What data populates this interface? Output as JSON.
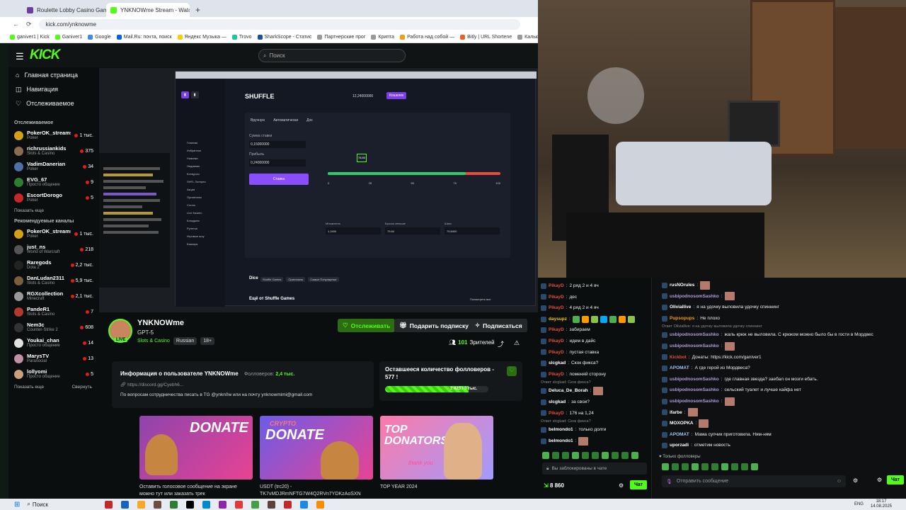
{
  "browser": {
    "tabs": [
      {
        "label": "Roulette Lobby Casino Game o",
        "color": "#6b3fa0",
        "active": false
      },
      {
        "label": "YNKNOWme Stream - Watch",
        "color": "#53fc18",
        "active": true
      }
    ],
    "url": "kick.com/ynknowme",
    "bookmarks": [
      "ganiver1 | Kick",
      "Ganiver1",
      "Google",
      "Mail.Ru: почта, поиск",
      "Яндекс Музыка —",
      "Trovo",
      "SharkScope - Статис",
      "Партнерские прог",
      "Крипта",
      "Работа над собой —",
      "Bitly | URL Shortene",
      "Калькулятор"
    ]
  },
  "kick": {
    "logo": "KICK",
    "search_placeholder": "Поиск",
    "nav": [
      {
        "label": "Главная страница",
        "icon": "home-icon"
      },
      {
        "label": "Навигация",
        "icon": "compass-icon"
      },
      {
        "label": "Отслеживаемое",
        "icon": "heart-icon"
      }
    ],
    "followed_title": "Отслеживаемое",
    "followed": [
      {
        "name": "PokerOK_streams",
        "cat": "Poker",
        "viewers": "1 тыс.",
        "color": "#d4a017"
      },
      {
        "name": "richrussiankids",
        "cat": "Slots & Casino",
        "viewers": "375",
        "color": "#8a6d4e"
      },
      {
        "name": "VadimDanerian",
        "cat": "Poker",
        "viewers": "34",
        "color": "#4f6fa8"
      },
      {
        "name": "EVG_67",
        "cat": "Просто общение",
        "viewers": "9",
        "color": "#2e7d32"
      },
      {
        "name": "EscortDorogo",
        "cat": "Poker",
        "viewers": "5",
        "color": "#c62828"
      }
    ],
    "show_more": "Показать еще",
    "recommended_title": "Рекомендуемые каналы",
    "recommended": [
      {
        "name": "PokerOK_streams",
        "cat": "Poker",
        "viewers": "1 тыс.",
        "color": "#d4a017"
      },
      {
        "name": "just_ns",
        "cat": "World of Warcraft",
        "viewers": "218",
        "color": "#555"
      },
      {
        "name": "Raregods",
        "cat": "Dota 2",
        "viewers": "2,2 тыс.",
        "color": "#222"
      },
      {
        "name": "DanLudan2311",
        "cat": "Slots & Casino",
        "viewers": "5,9 тыс.",
        "color": "#7b5e3b"
      },
      {
        "name": "RGXcollection",
        "cat": "Minecraft",
        "viewers": "2,1 тыс.",
        "color": "#999"
      },
      {
        "name": "PandeR1",
        "cat": "Slots & Casino",
        "viewers": "7",
        "color": "#b03a2e"
      },
      {
        "name": "Nem3c",
        "cat": "Counter-Strike 2",
        "viewers": "608",
        "color": "#333"
      },
      {
        "name": "Youkai_chan",
        "cat": "Просто общение",
        "viewers": "14",
        "color": "#e0e0e0"
      },
      {
        "name": "MarysTV",
        "cat": "Parasocial",
        "viewers": "13",
        "color": "#c28fa5"
      },
      {
        "name": "lollyomi",
        "cat": "Просто общение",
        "viewers": "5",
        "color": "#c9a07a"
      }
    ],
    "show_more2": "Показать еще",
    "collapse": "Свернуть"
  },
  "stream": {
    "channel": "YNKNOWme",
    "title": "GPT-5",
    "category": "Slots & Casino",
    "tags": [
      "Russian",
      "18+"
    ],
    "live": "LIVE",
    "follow_btn": "Отслеживать",
    "gift_btn": "Подарить подписку",
    "sub_btn": "Подписаться",
    "viewers_count": "101",
    "viewers_label": "Зрителей",
    "about_title": "Информация о пользователе YNKNOWme",
    "followers_label": "Фолловеров:",
    "followers_value": "2,4 тыс.",
    "discord": "https://discord.gg/Cyebh6...",
    "about_text": "По вопросам сотрудничества писать в TG @ynkn0w или на почту ynknowmimi@gmail.com",
    "goal_title": "Оставшееся количество фолловеров - 577 !",
    "goal_progress": "2 423 / 3 тыс.",
    "goal_fraction": 0.81,
    "panels": [
      {
        "caption": "Оставить голосовое сообщение на экране",
        "caption2": "можно тут или заказать трек",
        "big": "DONATE"
      },
      {
        "caption": "USDT (trc20) -",
        "caption2": "TK7vMDJRmNFTG7W4Q2RVn7YDKzAoSXN",
        "big": "DONATE",
        "small": "CRYPTO"
      },
      {
        "caption": "TOP YEAR 2024",
        "caption2": "",
        "big": "TOP DONATORS",
        "small": "thank you"
      }
    ]
  },
  "casino": {
    "brand": "SHUFFLE",
    "balance": "12,24000000",
    "deposit": "Кошелек",
    "game_tabs": [
      "Вручную",
      "Автоматически",
      "Дос"
    ],
    "bet_label": "Сумма ставки",
    "bet_value": "0,15000000",
    "profit_label": "Прибыль",
    "profit_value": "0,24000000",
    "bet_btn": "Ставка",
    "marker": "78.80",
    "scale": [
      "0",
      "25",
      "50",
      "75",
      "100"
    ],
    "multiplier_label": "Множитель",
    "multiplier_value": "1,2400",
    "roll_label": "Бросок меньше",
    "roll_value": "79.84",
    "chance_label": "Шанс",
    "chance_value": "79,8400",
    "section": "Dice",
    "section_tags": [
      "Shuffle Games",
      "Оригиналы",
      "Самые Популярные"
    ],
    "more": "Ещё от Shuffle Games",
    "see_all": "Посмотреть все",
    "side_menu": [
      "Главная",
      "Избранное",
      "Новинки",
      "Недавние",
      "Конкурсы",
      "SHFL Лотерея",
      "Акции",
      "Оригиналы",
      "Слоты",
      "Live Казино",
      "Блэкджек",
      "Рулетка",
      "Игровые шоу",
      "Баккара"
    ]
  },
  "chat_left": {
    "messages": [
      {
        "user": "PikayD",
        "text": "2 ряд 2 и 4 яч",
        "color": "#e74c3c"
      },
      {
        "user": "PikayD",
        "text": "дес",
        "color": "#e74c3c"
      },
      {
        "user": "PikayD",
        "text": "4 ряд 2 и 4 яч",
        "color": "#e74c3c"
      },
      {
        "user": "daysupz",
        "text": "",
        "color": "#f1c40f",
        "emotes": 7
      },
      {
        "user": "PikayD",
        "text": "забираем",
        "color": "#e74c3c"
      },
      {
        "user": "PikayD",
        "text": "идем в дайс",
        "color": "#e74c3c"
      },
      {
        "user": "PikayD",
        "text": "пустая ставка",
        "color": "#e74c3c"
      },
      {
        "user": "slcgkad",
        "text": "Скок фикса?",
        "color": "#ffffff"
      },
      {
        "user": "PikayD",
        "text": "поменяй сторону",
        "color": "#e74c3c"
      },
      {
        "user": "Deluca_De_Borah",
        "text": "",
        "color": "#ffffff",
        "reply": "Ответ slcgkad: Скок фикса?",
        "face": true
      },
      {
        "user": "slcgkad",
        "text": "за свои?",
        "color": "#ffffff"
      },
      {
        "user": "PikayD",
        "text": "176 на 1,24",
        "color": "#e74c3c"
      },
      {
        "user": "belmondo1",
        "text": "только долги",
        "color": "#ffffff",
        "reply": "Ответ slcgkad: Скок фикса?"
      },
      {
        "user": "belmondo1",
        "text": "",
        "color": "#ffffff",
        "face": true
      }
    ],
    "blocked": "Вы заблокированы в чате",
    "points": "8 860",
    "chat_btn": "Чат"
  },
  "chat_right": {
    "messages": [
      {
        "user": "rusNOrules",
        "text": "",
        "color": "#ffffff",
        "face": true
      },
      {
        "user": "usbipodnosomSashko",
        "text": "",
        "color": "#b39ddb",
        "face": true
      },
      {
        "user": "Oliviallive",
        "text": "я на удочку выловила удочку спиннинг",
        "color": "#ffffff"
      },
      {
        "user": "Pupsopups",
        "text": "Не плохо",
        "color": "#f39c12"
      },
      {
        "user": "usbipodnosomSashko",
        "text": "жаль крюк не выловила. С крюком можно было бы в гости в Мордвес",
        "color": "#b39ddb",
        "reply": "Ответ Oliviallive: я на удочку выловила удочку спиннинг"
      },
      {
        "user": "usbipodnosomSashko",
        "text": "",
        "color": "#b39ddb",
        "face": true
      },
      {
        "user": "Kickbot",
        "text": "Донаты: https://kick.com/ganiver1",
        "color": "#e74c3c"
      },
      {
        "user": "АРОМАТ",
        "text": "А где герой из Мордвеса?",
        "color": "#9fc5e8"
      },
      {
        "user": "usbipodnosomSashko",
        "text": "где главная звезда? заебал он мозги ебать.",
        "color": "#b39ddb"
      },
      {
        "user": "usbipodnosomSashko",
        "text": "сельский туалет и лучше кайфа нет",
        "color": "#b39ddb"
      },
      {
        "user": "usbipodnosomSashko",
        "text": "",
        "color": "#b39ddb",
        "face": true
      },
      {
        "user": "ifarbe",
        "text": "",
        "color": "#ffffff",
        "face": true
      },
      {
        "user": "MOXOPKA",
        "text": "",
        "color": "#ffffff",
        "face": true
      },
      {
        "user": "АРОМАТ",
        "text": "Мама супчик приготовила. Ням-ням",
        "color": "#9fc5e8"
      },
      {
        "user": "uporzadi",
        "text": "отметим новость",
        "color": "#ffffff"
      }
    ],
    "followers_only": "Только фолловеры",
    "input_placeholder": "Отправить сообщение",
    "chat_btn": "Чат"
  },
  "taskbar": {
    "search": "Поиск",
    "time": "18:17",
    "date": "14.08.2025",
    "lang": "ENG"
  }
}
